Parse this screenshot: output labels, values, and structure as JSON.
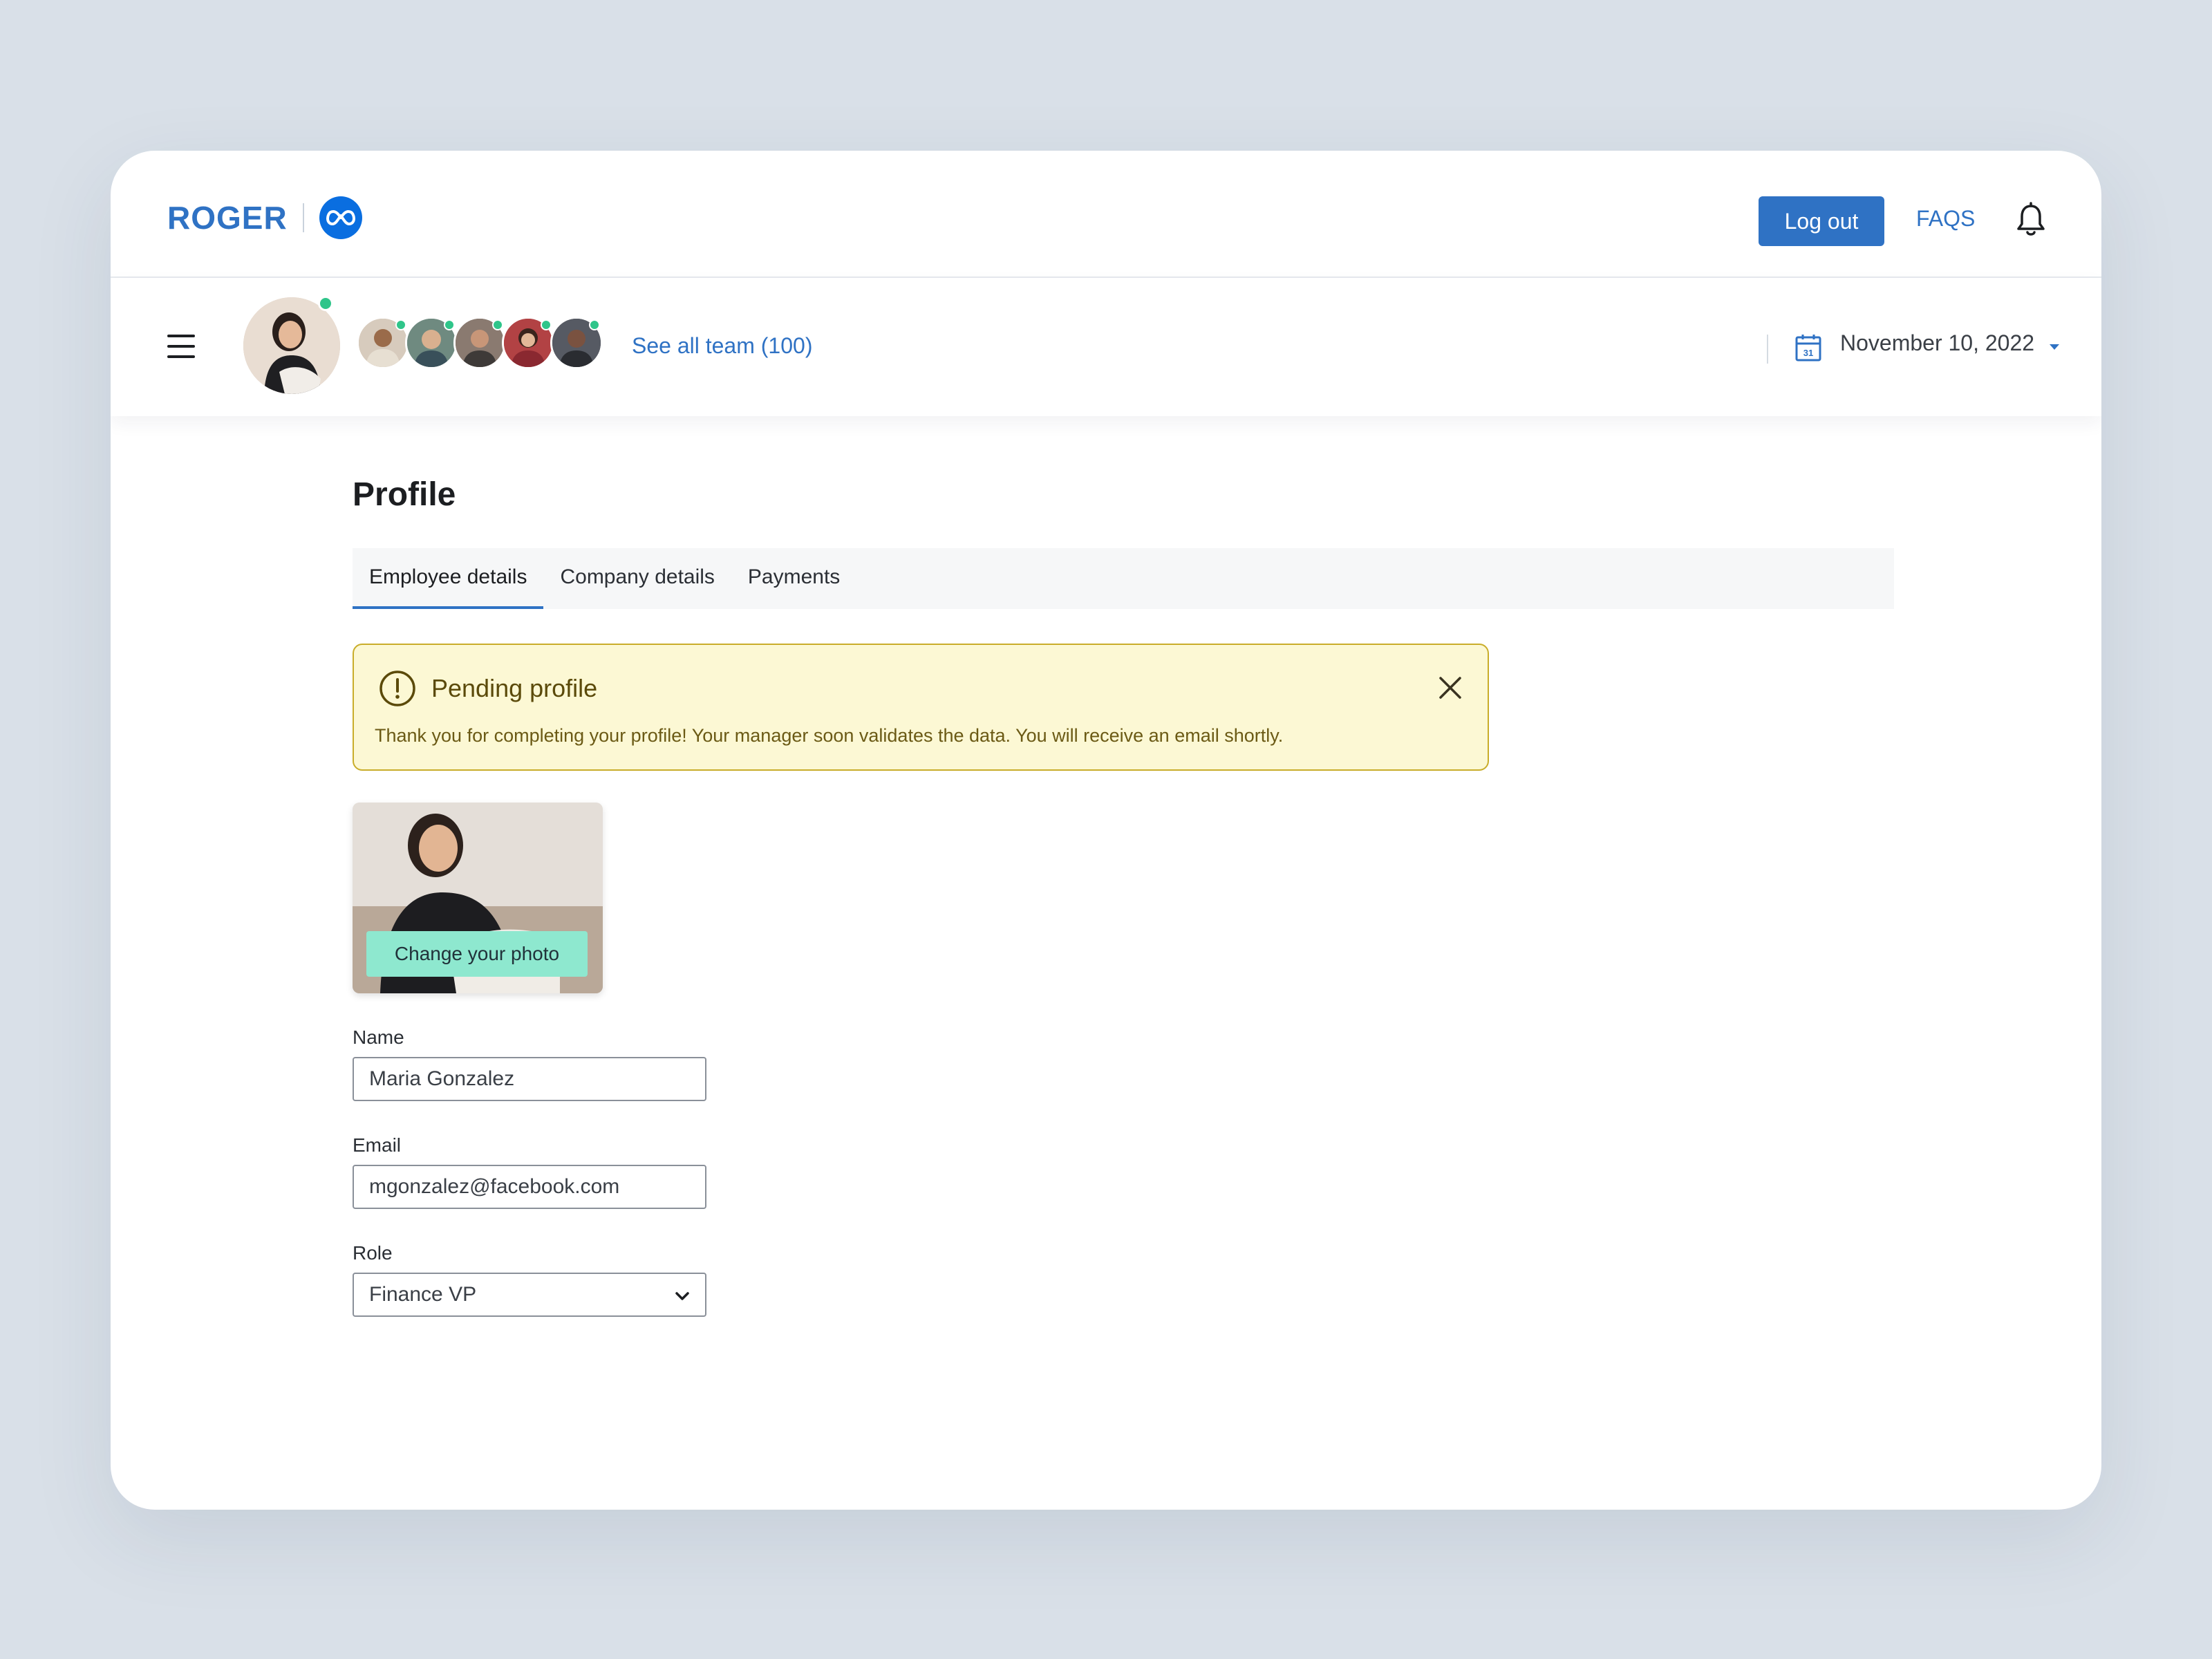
{
  "header": {
    "brand": "ROGER",
    "logout_label": "Log out",
    "faqs_label": "FAQS"
  },
  "team": {
    "see_all_label": "See all team (100)",
    "date": "November 10, 2022"
  },
  "page": {
    "title": "Profile",
    "tabs": [
      {
        "label": "Employee details",
        "active": true
      },
      {
        "label": "Company details",
        "active": false
      },
      {
        "label": "Payments",
        "active": false
      }
    ]
  },
  "alert": {
    "title": "Pending profile",
    "message": "Thank you for completing your profile! Your manager soon validates the data. You will receive an email shortly."
  },
  "photo": {
    "button_label": "Change your photo"
  },
  "form": {
    "name_label": "Name",
    "name_value": "Maria Gonzalez",
    "email_label": "Email",
    "email_value": "mgonzalez@facebook.com",
    "role_label": "Role",
    "role_value": "Finance VP"
  },
  "colors": {
    "primary": "#2f72c4",
    "online": "#2fc58a",
    "alert_bg": "#fcf8d4",
    "alert_border": "#c9ad2a",
    "photo_button": "#8ee8cf"
  }
}
